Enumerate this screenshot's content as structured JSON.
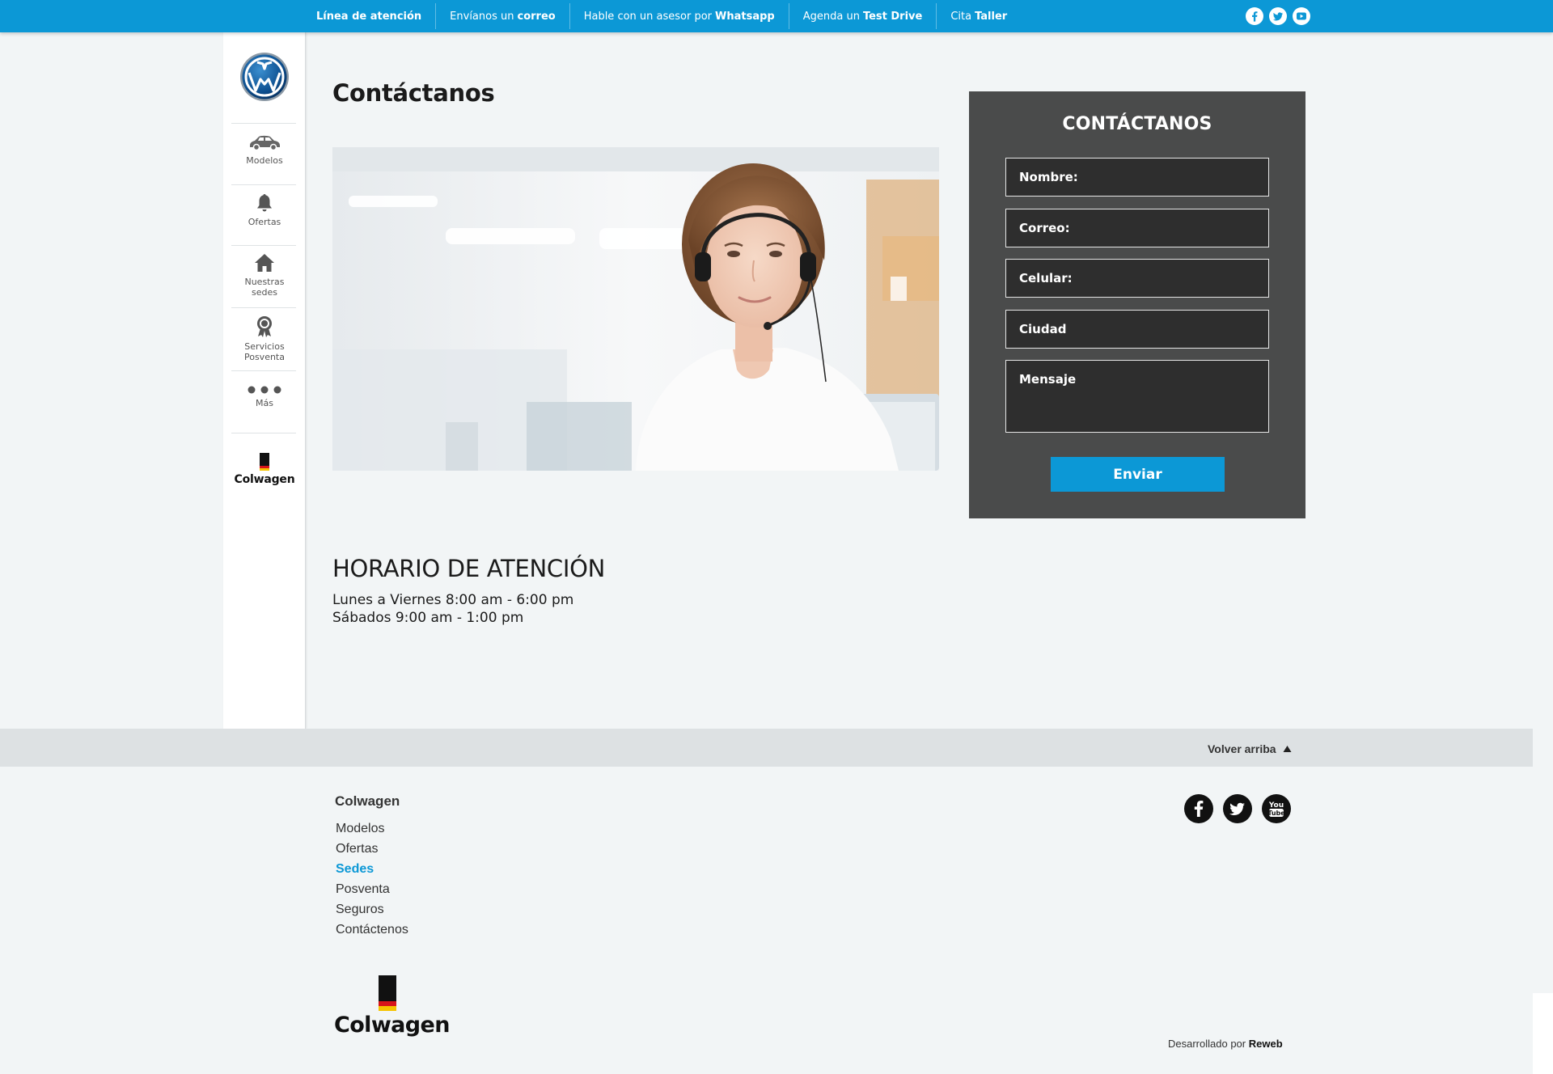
{
  "topbar": {
    "links": [
      {
        "pre": "",
        "bold": "Línea de atención"
      },
      {
        "pre": "Envíanos un",
        "bold": "correo"
      },
      {
        "pre": "Hable con un asesor por",
        "bold": "Whatsapp"
      },
      {
        "pre": "Agenda un",
        "bold": "Test Drive"
      },
      {
        "pre": "Cita",
        "bold": "Taller"
      }
    ],
    "social_icons": [
      "facebook-icon",
      "twitter-icon",
      "youtube-icon"
    ]
  },
  "sidebar": {
    "items": [
      {
        "label": "Modelos",
        "icon": "car-icon"
      },
      {
        "label": "Ofertas",
        "icon": "bell-icon"
      },
      {
        "label": "Nuestras sedes",
        "icon": "home-icon"
      },
      {
        "label": "Servicios Posventa",
        "icon": "award-icon"
      },
      {
        "label": "Más",
        "icon": "more-dots-icon"
      }
    ],
    "brand": "Colwagen"
  },
  "main": {
    "title": "Contáctanos",
    "hours_title": "HORARIO DE ATENCIÓN",
    "hours": [
      "Lunes a Viernes 8:00 am - 6:00 pm",
      "Sábados 9:00 am - 1:00 pm"
    ]
  },
  "form": {
    "title": "CONTÁCTANOS",
    "name_placeholder": "Nombre:",
    "email_placeholder": "Correo:",
    "phone_placeholder": "Celular:",
    "city_placeholder": "Ciudad",
    "message_placeholder": "Mensaje",
    "submit_label": "Enviar"
  },
  "footer": {
    "back_to_top": "Volver arriba",
    "title": "Colwagen",
    "links": [
      "Modelos",
      "Ofertas",
      "Sedes",
      "Posventa",
      "Seguros",
      "Contáctenos"
    ],
    "active_link": "Sedes",
    "brand": "Colwagen",
    "credit_prefix": "Desarrollado por",
    "credit_name": "Reweb"
  },
  "colors": {
    "accent": "#0c98d6",
    "form_bg": "#4a4b4b",
    "page_bg": "#f2f5f6"
  }
}
